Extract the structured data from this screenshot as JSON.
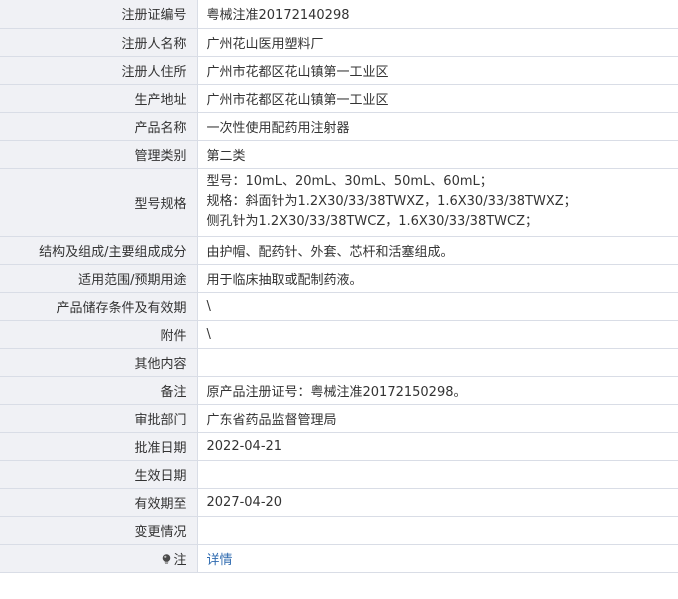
{
  "rows": [
    {
      "label": "注册证编号",
      "value": "粤械注准20172140298"
    },
    {
      "label": "注册人名称",
      "value": "广州花山医用塑料厂"
    },
    {
      "label": "注册人住所",
      "value": "广州市花都区花山镇第一工业区"
    },
    {
      "label": "生产地址",
      "value": "广州市花都区花山镇第一工业区"
    },
    {
      "label": "产品名称",
      "value": "一次性使用配药用注射器"
    },
    {
      "label": "管理类别",
      "value": "第二类"
    },
    {
      "label": "型号规格",
      "lines": [
        "型号：10mL、20mL、30mL、50mL、60mL；",
        "规格：斜面针为1.2X30/33/38TWXZ，1.6X30/33/38TWXZ；",
        "侧孔针为1.2X30/33/38TWCZ，1.6X30/33/38TWCZ；"
      ]
    },
    {
      "label": "结构及组成/主要组成成分",
      "value": "由护帽、配药针、外套、芯杆和活塞组成。"
    },
    {
      "label": "适用范围/预期用途",
      "value": "用于临床抽取或配制药液。"
    },
    {
      "label": "产品储存条件及有效期",
      "value": "\\"
    },
    {
      "label": "附件",
      "value": "\\"
    },
    {
      "label": "其他内容",
      "value": ""
    },
    {
      "label": "备注",
      "value": "原产品注册证号：粤械注准20172150298。"
    },
    {
      "label": "审批部门",
      "value": "广东省药品监督管理局"
    },
    {
      "label": "批准日期",
      "value": "2022-04-21"
    },
    {
      "label": "生效日期",
      "value": ""
    },
    {
      "label": "有效期至",
      "value": "2027-04-20"
    },
    {
      "label": "变更情况",
      "value": ""
    },
    {
      "label": "注",
      "value": "详情",
      "icon": "lightbulb-icon"
    }
  ],
  "colors": {
    "label_bg": "#f0f1f5",
    "border": "#d9dde6",
    "link": "#2f6bb0"
  }
}
